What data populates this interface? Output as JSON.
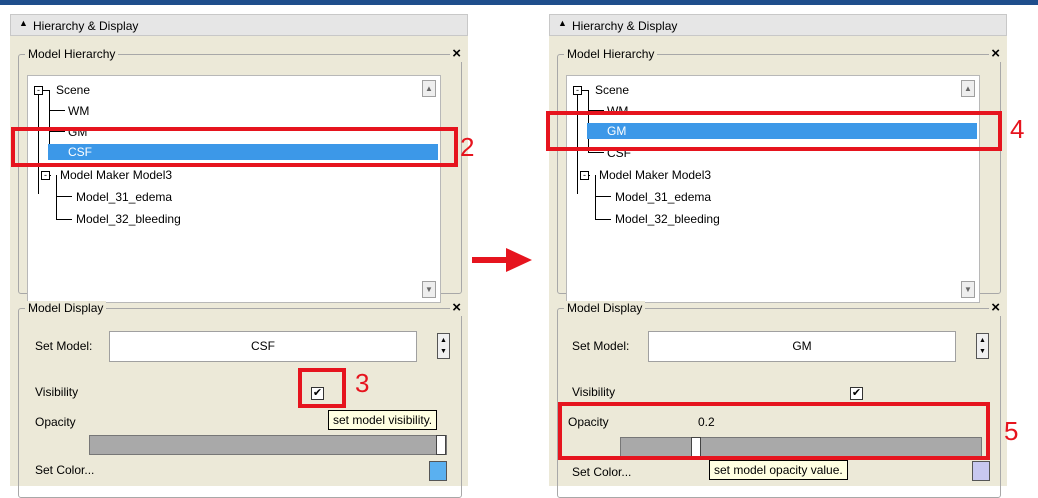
{
  "colors": {
    "annotation": "#e6141e",
    "selection": "#3c98e8",
    "swatch_left": "#5ab0f0",
    "swatch_right": "#c8c8f0"
  },
  "left": {
    "header_title": "Hierarchy & Display",
    "hierarchy_title": "Model Hierarchy",
    "tree": {
      "scene": "Scene",
      "wm": "WM",
      "gm": "GM",
      "csf": "CSF",
      "maker": "Model Maker Model3",
      "edema": "Model_31_edema",
      "bleeding": "Model_32_bleeding",
      "selected": "CSF"
    },
    "display_title": "Model Display",
    "set_model_label": "Set Model:",
    "set_model_value": "CSF",
    "visibility_label": "Visibility",
    "visibility_checked": true,
    "opacity_label": "Opacity",
    "opacity_value": 1.0,
    "set_color_label": "Set Color...",
    "tooltip": "set model visibility."
  },
  "right": {
    "header_title": "Hierarchy & Display",
    "hierarchy_title": "Model Hierarchy",
    "tree": {
      "scene": "Scene",
      "wm": "WM",
      "gm": "GM",
      "csf": "CSF",
      "maker": "Model Maker Model3",
      "edema": "Model_31_edema",
      "bleeding": "Model_32_bleeding",
      "selected": "GM"
    },
    "display_title": "Model Display",
    "set_model_label": "Set Model:",
    "set_model_value": "GM",
    "visibility_label": "Visibility",
    "visibility_checked": true,
    "opacity_label": "Opacity",
    "opacity_value_text": "0.2",
    "opacity_value": 0.2,
    "set_color_label": "Set Color...",
    "tooltip": "set model opacity value."
  },
  "annotations": {
    "n2": "2",
    "n3": "3",
    "n4": "4",
    "n5": "5"
  },
  "icons": {
    "collapse": "triangle-up-icon",
    "close": "close-icon",
    "next": "right-arrow-icon"
  }
}
